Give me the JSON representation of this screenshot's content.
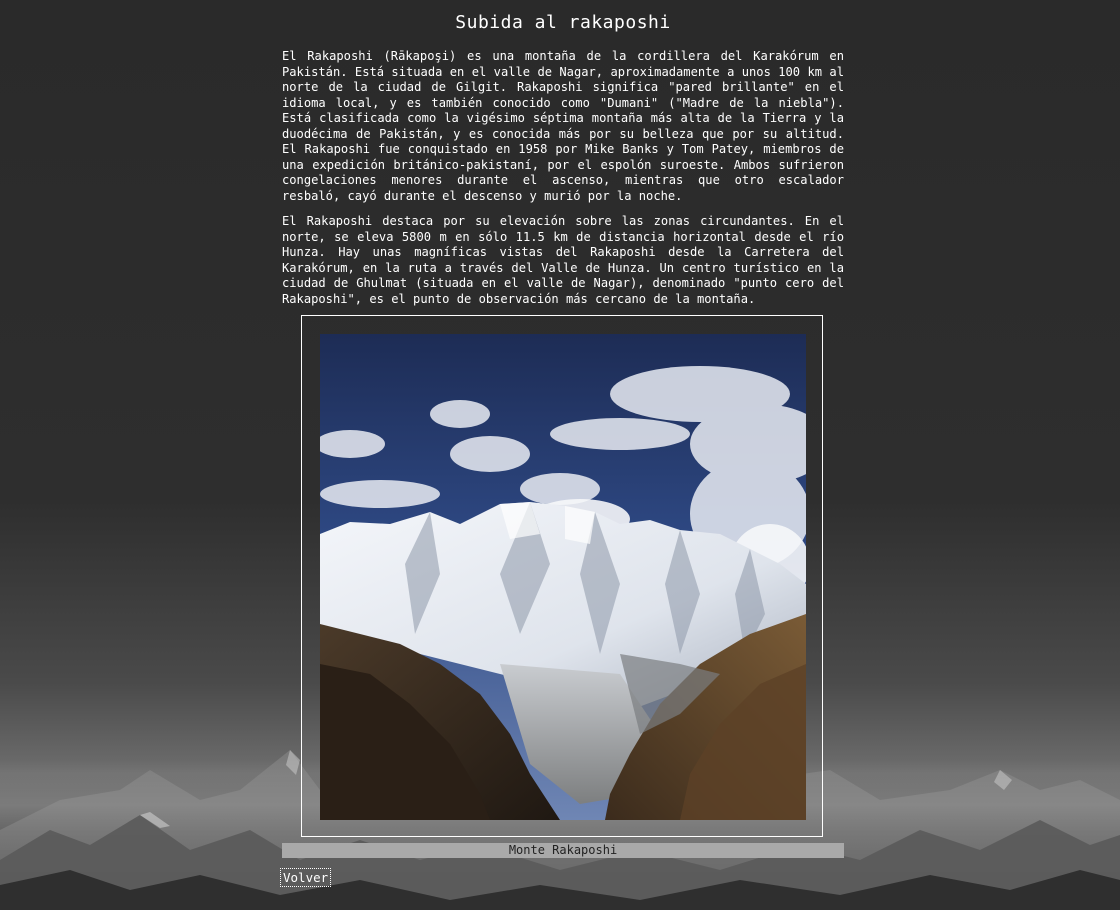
{
  "page": {
    "title": "Subida al rakaposhi"
  },
  "article": {
    "paragraphs": [
      "El Rakaposhi (Rākapoşi) es una montaña de la cordillera del Karakórum en Pakistán. Está situada en el valle de Nagar, aproximadamente a unos 100 km al norte de la ciudad de Gilgit. Rakaposhi significa \"pared brillante\" en el idioma local, y es también conocido como \"Dumani\" (\"Madre de la niebla\"). Está clasificada como la vigésimo séptima montaña más alta de la Tierra y la duodécima de Pakistán, y es conocida más por su belleza que por su altitud. El Rakaposhi fue conquistado en 1958 por Mike Banks y Tom Patey, miembros de una expedición británico-pakistaní, por el espolón suroeste. Ambos sufrieron congelaciones menores durante el ascenso, mientras que otro escalador resbaló, cayó durante el descenso y murió por la noche.",
      "El Rakaposhi destaca por su elevación sobre las zonas circundantes. En el norte, se eleva 5800 m en sólo 11.5 km de distancia horizontal desde el río Hunza. Hay unas magníficas vistas del Rakaposhi desde la Carretera del Karakórum, en la ruta a través del Valle de Hunza. Un centro turístico en la ciudad de Ghulmat (situada en el valle de Nagar), denominado \"punto cero del Rakaposhi\", es el punto de observación más cercano de la montaña."
    ]
  },
  "figure": {
    "caption": "Monte Rakaposhi"
  },
  "nav": {
    "back_label": "Volver"
  }
}
